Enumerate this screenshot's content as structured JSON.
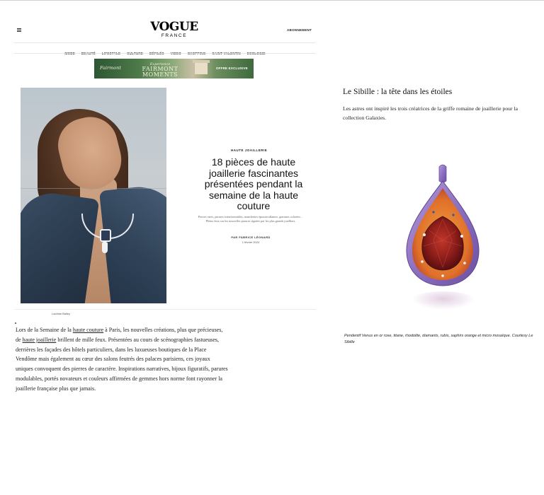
{
  "header": {
    "menu_icon": "hamburger-icon",
    "logo_main": "VOGUE",
    "logo_sub": "FRANCE",
    "subscribe": "ABONNEMENT"
  },
  "nav": {
    "items": [
      "MODE",
      "BEAUTÉ",
      "LIFESTYLE",
      "CULTURE",
      "DÉFILÉS",
      "VIDEO",
      "SHOPPING",
      "SAINT-VALENTIN",
      "ECOLOGIE"
    ]
  },
  "ad": {
    "brand": "Fairmont",
    "line1": "Experience",
    "line2": "FAIRMONT",
    "line3": "MOMENTS",
    "offer": "OFFRE EXCLUSIVE"
  },
  "article": {
    "kicker": "HAUTE JOAILLERIE",
    "headline": "18 pièces de haute joaillerie fascinantes présentées pendant la semaine de la haute couture",
    "dek": "Pierres rares, parures transformables, manchettes époustouflantes, gemmes colorées… Pleins feux sur les nouvelles parures signées par les plus grands joailliers.",
    "byline": "PAR FABRICE LÉONARD",
    "date": "1 février 2024",
    "photo_credit": "Lachlan Bailey",
    "body": {
      "p1": "Lors de la Semaine de la ",
      "link1": "haute couture",
      "p2": " à Paris, les nouvelles créations, plus que précieuses, de ",
      "link2": "haute joaillerie",
      "p3": " brillent de mille feux. Présentées au cours de scénographies fastueuses, derrières les façades des hôtels particuliers, dans les luxueuses boutiques de la Place Vendôme mais également au cœur des salons feutrés des palaces parisiens, ces joyaux uniques convoquent des pierres de caractère. Inspirations narratives, bijoux figuratifs, parures modulables, portés novateurs et couleurs affirmées de gemmes hors norme font rayonner la joaillerie française plus que jamais."
    }
  },
  "sidebar": {
    "title": "Le Sibille : la tête dans les étoiles",
    "text": "Les astres ont inspiré les trois créatrices de la griffe romaine de joaillerie pour la collection Galaxies.",
    "caption": "Pendentif Venus en or rose, titane, rhodolite, diamants, rubis, saphirs orange et micro mosaïque. Courtesy Le Sibille"
  },
  "colors": {
    "jewel_titanium": "#8c6fc0",
    "jewel_orange": "#e0702a",
    "jewel_rhodolite": "#8e1e1a"
  }
}
